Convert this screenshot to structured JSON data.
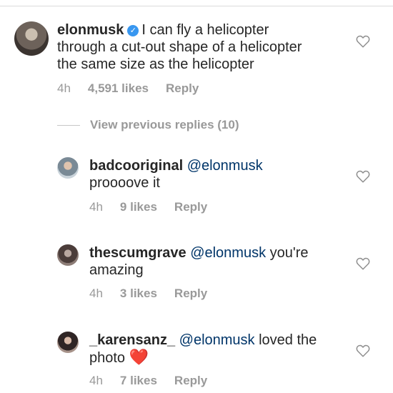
{
  "main_comment": {
    "username": "elonmusk",
    "verified_icon": "verified-badge-icon",
    "text": "I can fly a helicopter through a cut-out shape of a helicopter the same size as the helicopter",
    "line1": "I can fly a helicopter",
    "line2": "through a cut-out shape of a helicopter",
    "line3": "the same size as the helicopter",
    "time": "4h",
    "likes": "4,591 likes",
    "reply": "Reply"
  },
  "view_previous": "View previous replies (10)",
  "replies": [
    {
      "username": "badcooriginal",
      "mention": "@elonmusk",
      "text_line1": "",
      "text_line2": "proooove it",
      "time": "4h",
      "likes": "9 likes",
      "reply": "Reply"
    },
    {
      "username": "thescumgrave",
      "mention": "@elonmusk",
      "text_line1": " you're",
      "text_line2": "amazing",
      "time": "4h",
      "likes": "3 likes",
      "reply": "Reply"
    },
    {
      "username": "_karensanz_",
      "mention": "@elonmusk",
      "text_line1": " loved the",
      "text_line2": "photo ",
      "emoji": "❤️",
      "time": "4h",
      "likes": "7 likes",
      "reply": "Reply"
    }
  ],
  "icons": {
    "like": "heart-outline-icon"
  },
  "colors": {
    "text": "#262626",
    "meta": "#999999",
    "mention": "#003569",
    "verified": "#3897f0"
  }
}
